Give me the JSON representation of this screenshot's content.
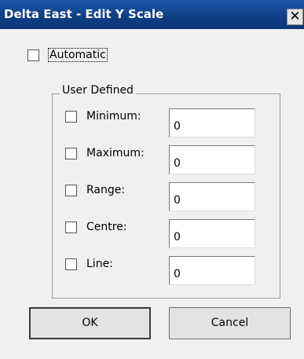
{
  "window": {
    "title": "Delta East - Edit Y Scale",
    "close_glyph": "✕",
    "title_bar_color": "#0f3f86"
  },
  "automatic": {
    "label": "Automatic",
    "checked": false
  },
  "user_defined": {
    "title": "User Defined",
    "rows": [
      {
        "label": "Minimum:",
        "value": "0",
        "checked": false
      },
      {
        "label": "Maximum:",
        "value": "0",
        "checked": false
      },
      {
        "label": "Range:",
        "value": "0",
        "checked": false
      },
      {
        "label": "Centre:",
        "value": "0",
        "checked": false
      },
      {
        "label": "Line:",
        "value": "0",
        "checked": false
      }
    ]
  },
  "buttons": {
    "ok": "OK",
    "cancel": "Cancel"
  }
}
